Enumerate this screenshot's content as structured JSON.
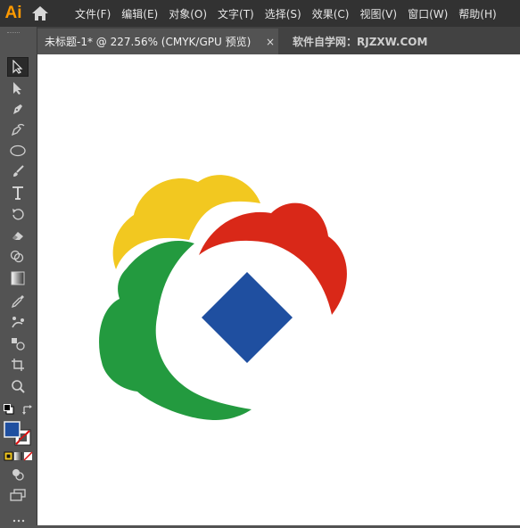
{
  "app": {
    "logo_text": "Ai",
    "home_icon": "home-icon"
  },
  "menu": [
    {
      "label": "文件(F)"
    },
    {
      "label": "编辑(E)"
    },
    {
      "label": "对象(O)"
    },
    {
      "label": "文字(T)"
    },
    {
      "label": "选择(S)"
    },
    {
      "label": "效果(C)"
    },
    {
      "label": "视图(V)"
    },
    {
      "label": "窗口(W)"
    },
    {
      "label": "帮助(H)"
    }
  ],
  "tabs": {
    "active_label": "未标题-1* @ 227.56% (CMYK/GPU 预览)",
    "close_glyph": "×",
    "other_label": "软件自学网：RJZXW.COM"
  },
  "tools": [
    "selection-tool-icon",
    "direct-selection-tool-icon",
    "pen-tool-icon",
    "curvature-tool-icon",
    "ellipse-tool-icon",
    "paintbrush-tool-icon",
    "type-tool-icon",
    "rotate-tool-icon",
    "eraser-tool-icon",
    "shape-builder-tool-icon",
    "gradient-tool-icon",
    "eyedropper-tool-icon",
    "puppet-warp-tool-icon",
    "symbol-sprayer-tool-icon",
    "artboard-tool-icon",
    "zoom-tool-icon"
  ],
  "colors": {
    "fill": "#1f4fa0",
    "stroke": "none",
    "logo_yellow": "#f2c820",
    "logo_red": "#d92818",
    "logo_green": "#239a3f",
    "logo_blue": "#1f4fa0"
  }
}
